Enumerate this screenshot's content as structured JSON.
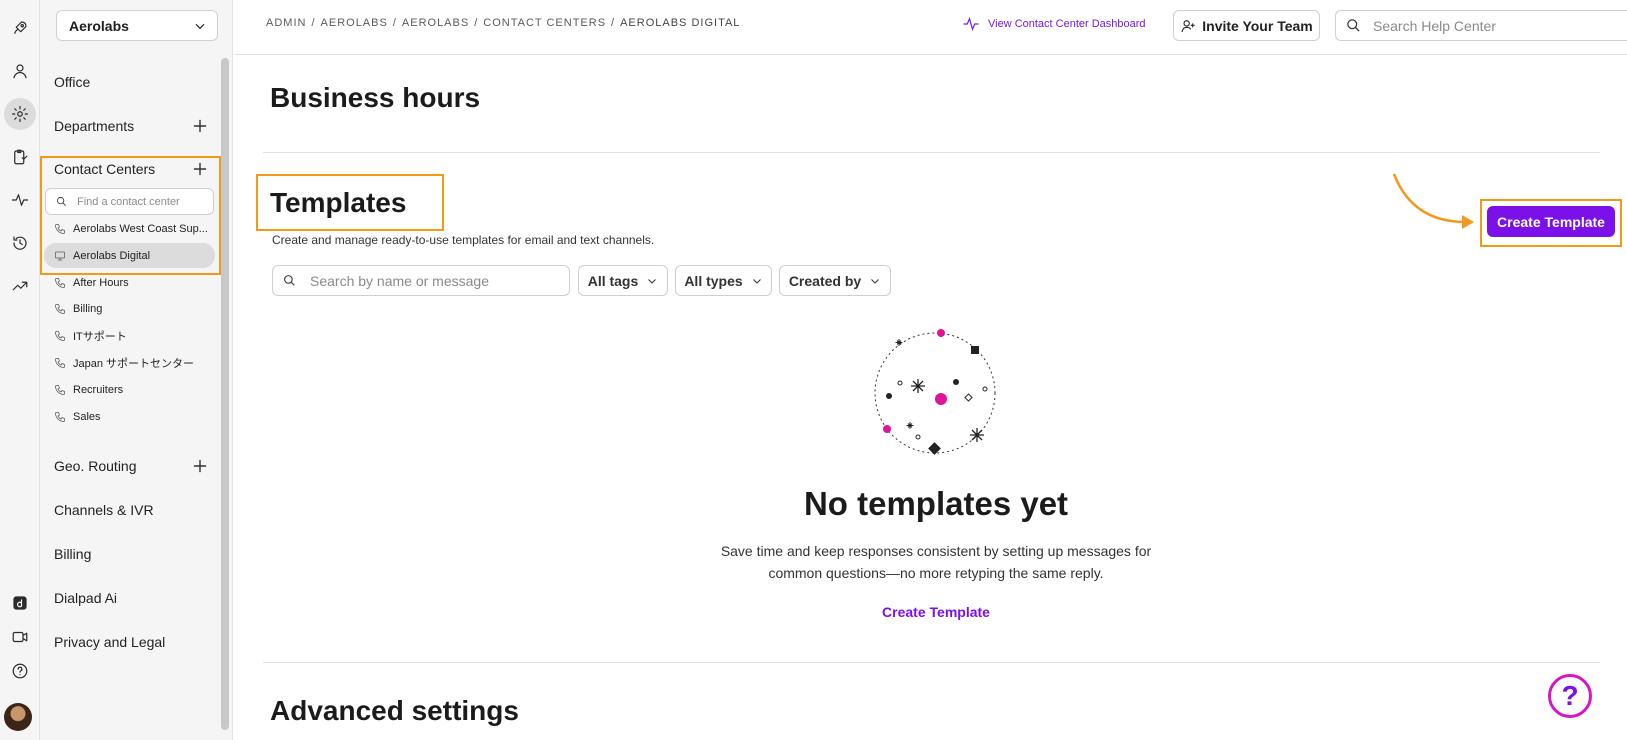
{
  "org": {
    "name": "Aerolabs"
  },
  "sidebar": {
    "items": [
      {
        "label": "Office"
      },
      {
        "label": "Departments"
      },
      {
        "label": "Contact Centers"
      },
      {
        "label": "Geo. Routing"
      },
      {
        "label": "Channels & IVR"
      },
      {
        "label": "Billing"
      },
      {
        "label": "Dialpad Ai"
      },
      {
        "label": "Privacy and Legal"
      }
    ],
    "contact_center_search": {
      "placeholder": "Find a contact center"
    },
    "contact_centers": [
      {
        "label": "Aerolabs West Coast Sup...",
        "icon": "phone-icon"
      },
      {
        "label": "Aerolabs Digital",
        "icon": "monitor-icon",
        "selected": true
      },
      {
        "label": "After Hours",
        "icon": "phone-icon"
      },
      {
        "label": "Billing",
        "icon": "phone-icon"
      },
      {
        "label": "ITサポート",
        "icon": "phone-icon"
      },
      {
        "label": "Japan サポートセンター",
        "icon": "phone-icon"
      },
      {
        "label": "Recruiters",
        "icon": "phone-icon"
      },
      {
        "label": "Sales",
        "icon": "phone-icon"
      }
    ]
  },
  "breadcrumb": {
    "items": [
      "ADMIN",
      "AEROLABS",
      "AEROLABS",
      "CONTACT CENTERS",
      "AEROLABS DIGITAL"
    ],
    "separator": "/"
  },
  "header": {
    "dashboard_link": "View Contact Center Dashboard",
    "invite_button": "Invite Your Team",
    "help_search_placeholder": "Search Help Center"
  },
  "main": {
    "business_hours_title": "Business hours",
    "templates_title": "Templates",
    "templates_subtitle": "Create and manage ready-to-use templates for email and text channels.",
    "search_placeholder": "Search by name or message",
    "filters": [
      "All tags",
      "All types",
      "Created by"
    ],
    "create_button": "Create Template",
    "empty_title": "No templates yet",
    "empty_desc_line1": "Save time and keep responses consistent by setting up messages for",
    "empty_desc_line2": "common questions—no more retyping the same reply.",
    "empty_link": "Create Template",
    "advanced_title": "Advanced settings"
  },
  "help_fab": "?",
  "colors": {
    "accent": "#7c10e8",
    "highlight": "#f0991b",
    "magenta": "#d417c6"
  }
}
